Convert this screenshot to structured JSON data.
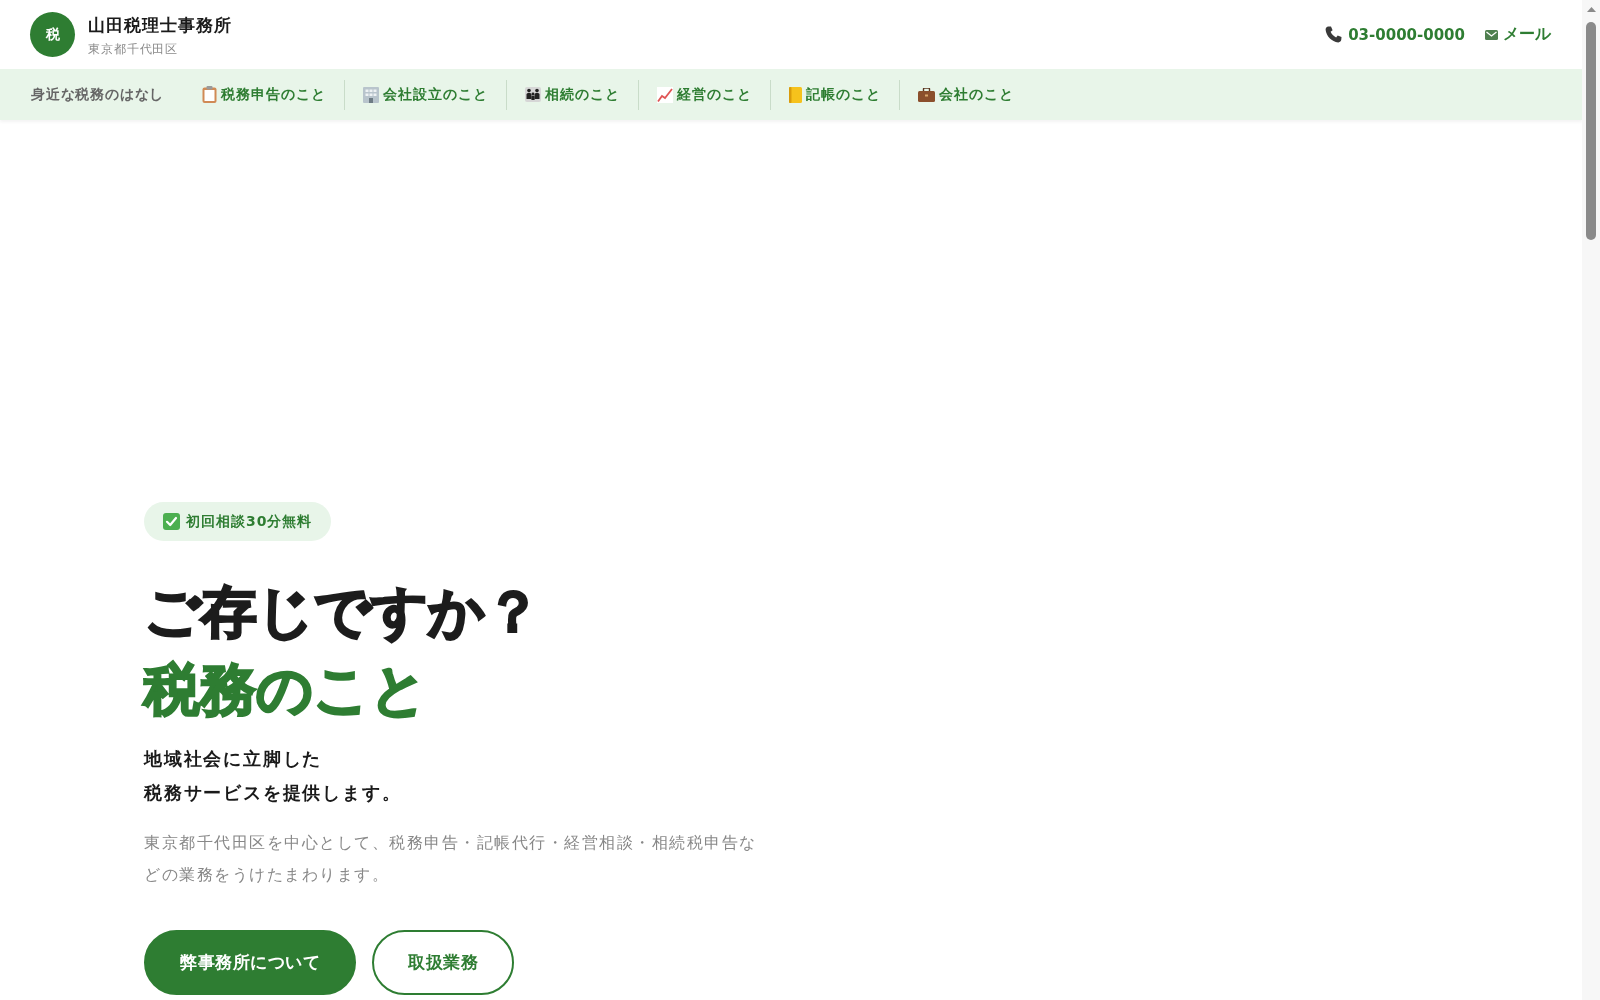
{
  "header": {
    "logo": "税",
    "title": "山田税理士事務所",
    "subtitle": "東京都千代田区",
    "contact": [
      {
        "kind": "phone",
        "label": "03-0000-0000"
      },
      {
        "kind": "mail",
        "label": "メール"
      }
    ]
  },
  "nav": {
    "label": "身近な税務のはなし",
    "items": [
      "税務申告のこと",
      "会社設立のこと",
      "相続のこと",
      "経営のこと",
      "記帳のこと",
      "会社のこと"
    ]
  },
  "hero": {
    "badge": "初回相談30分無料",
    "heading": [
      {
        "kind": "plain",
        "text": "ご存じですか？"
      },
      {
        "kind": "accent",
        "text": "税務のこと"
      }
    ],
    "tagline": [
      "地域社会に立脚した",
      "税務サービスを提供します。"
    ],
    "description": "東京都千代田区を中心として、税務申告・記帳代行・経営相談・相続税申告などの業務をうけたまわります。",
    "buttons": [
      {
        "kind": "primary",
        "label": "弊事務所について"
      },
      {
        "kind": "outline",
        "label": "取扱業務"
      }
    ]
  }
}
